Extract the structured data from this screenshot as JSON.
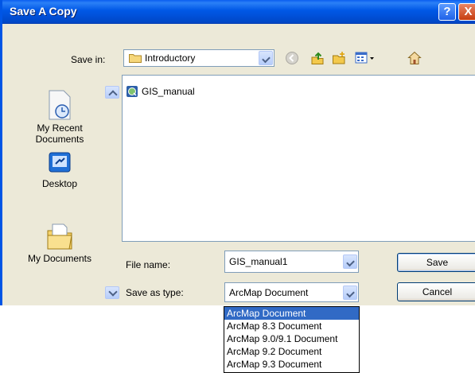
{
  "window": {
    "title": "Save A Copy"
  },
  "title_buttons": {
    "help": "?",
    "close": "X"
  },
  "save_in": {
    "label": "Save in:",
    "value": "Introductory"
  },
  "toolbar": {
    "back_icon": "back-arrow-icon",
    "up_icon": "up-folder-icon",
    "new_folder_icon": "new-folder-icon",
    "views_icon": "views-menu-icon",
    "home_icon": "home-icon"
  },
  "places": [
    {
      "label": "My Recent Documents",
      "icon": "recent-documents-icon"
    },
    {
      "label": "Desktop",
      "icon": "desktop-icon"
    },
    {
      "label": "My Documents",
      "icon": "my-documents-icon"
    }
  ],
  "files": [
    {
      "name": "GIS_manual",
      "icon": "arcmap-document-icon"
    }
  ],
  "file_name": {
    "label": "File name:",
    "value": "GIS_manual1"
  },
  "save_as_type": {
    "label": "Save as type:",
    "value": "ArcMap Document"
  },
  "buttons": {
    "save": "Save",
    "cancel": "Cancel"
  },
  "type_options": [
    "ArcMap Document",
    "ArcMap 8.3 Document",
    "ArcMap 9.0/9.1 Document",
    "ArcMap 9.2 Document",
    "ArcMap 9.3 Document"
  ],
  "selected_type_index": 0,
  "colors": {
    "titlebar": "#0058e6",
    "dialog_bg": "#ece9d8",
    "selection": "#316ac5",
    "field_border": "#7f9db9"
  }
}
